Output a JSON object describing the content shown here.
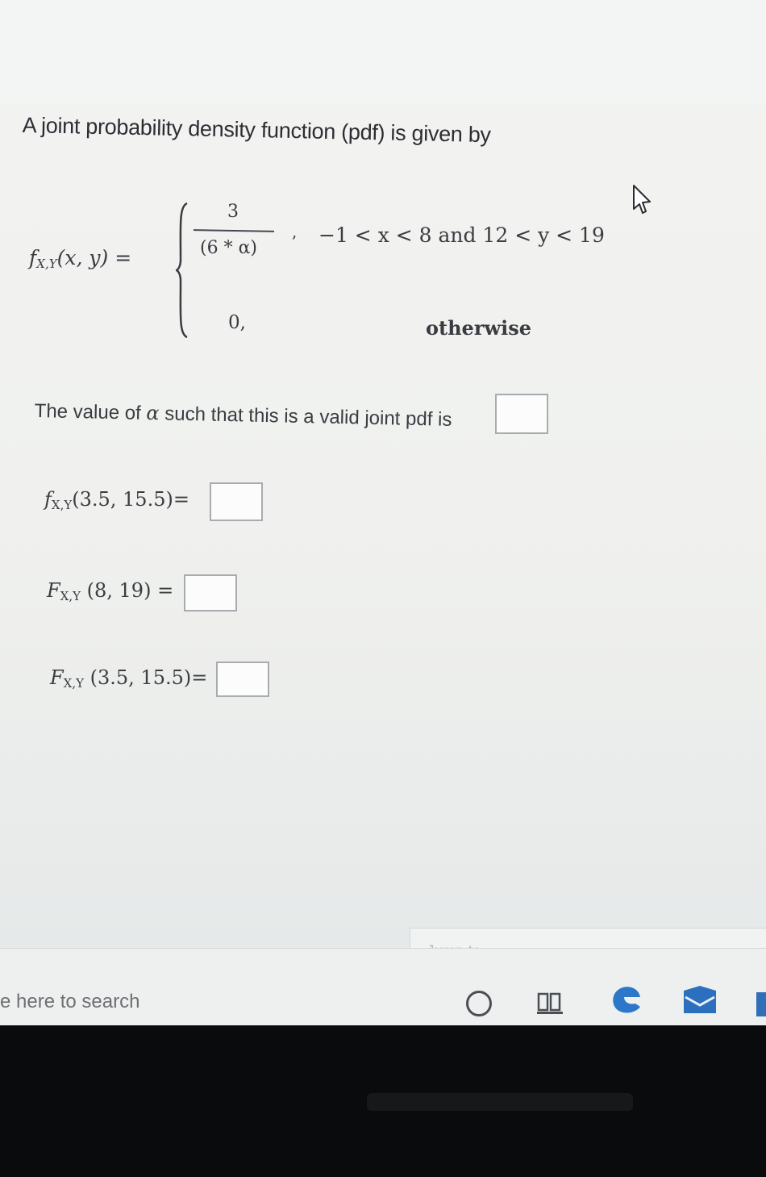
{
  "question": {
    "intro": "A joint probability density function (pdf) is given by"
  },
  "pdf": {
    "lhs_main": "f",
    "lhs_sub": "X,Y",
    "lhs_args": "(x, y) =",
    "numerator": "3",
    "denominator": "(6 * α)",
    "comma": ",",
    "condition1": "−1 < x < 8  and  12 < y < 19",
    "zero": "0,",
    "condition2": "otherwise"
  },
  "alpha_prompt": {
    "text_before": "The value of ",
    "symbol": "α",
    "text_after": " such that this is a valid joint pdf is"
  },
  "eq_pdf_point": {
    "main": "f",
    "sub": "X,Y",
    "args": "(3.5, 15.5)="
  },
  "eq_cdf_full": {
    "main": "F",
    "sub": "X,Y",
    "args": " (8, 19) ="
  },
  "eq_cdf_point": {
    "main": "F",
    "sub": "X,Y",
    "args": " (3.5, 15.5)="
  },
  "answers": {
    "alpha": "",
    "pdf_point": "",
    "cdf_full": "",
    "cdf_point": ""
  },
  "taskbar": {
    "jump_to": "Jump to...",
    "search_placeholder": "e here to search"
  },
  "icons": [
    "cursor-icon",
    "cortana-icon",
    "task-view-icon",
    "edge-icon",
    "mail-icon"
  ],
  "colors": {
    "edge": "#2c77c9",
    "mail": "#2d6fbf",
    "text": "#3a3c42"
  }
}
